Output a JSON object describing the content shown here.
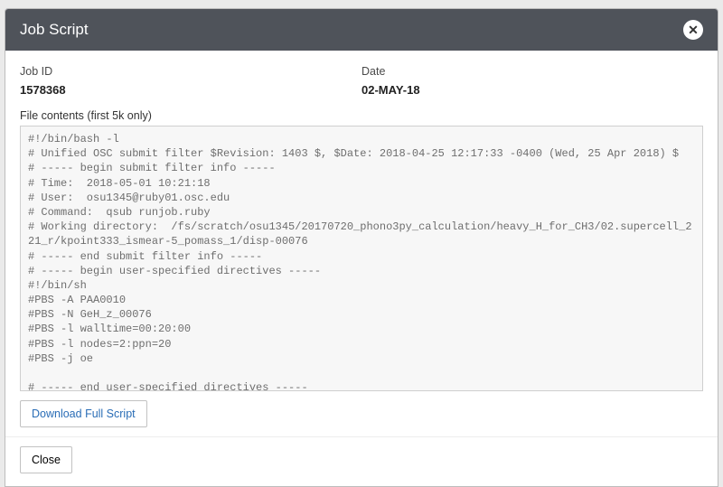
{
  "modal": {
    "title": "Job Script",
    "close_icon": "✕",
    "meta": {
      "job_id_label": "Job ID",
      "job_id_value": "1578368",
      "date_label": "Date",
      "date_value": "02-MAY-18"
    },
    "file_contents_label": "File contents (first 5k only)",
    "file_contents": "#!/bin/bash -l\n# Unified OSC submit filter $Revision: 1403 $, $Date: 2018-04-25 12:17:33 -0400 (Wed, 25 Apr 2018) $\n# ----- begin submit filter info -----\n# Time:  2018-05-01 10:21:18\n# User:  osu1345@ruby01.osc.edu\n# Command:  qsub runjob.ruby\n# Working directory:  /fs/scratch/osu1345/20170720_phono3py_calculation/heavy_H_for_CH3/02.supercell_221_r/kpoint333_ismear-5_pomass_1/disp-00076\n# ----- end submit filter info -----\n# ----- begin user-specified directives -----\n#!/bin/sh\n#PBS -A PAA0010\n#PBS -N GeH_z_00076\n#PBS -l walltime=00:20:00\n#PBS -l nodes=2:ppn=20\n#PBS -j oe\n\n# ----- end user-specified directives -----\n# ----- begin submit filter added directives -----",
    "download_button": "Download Full Script",
    "close_button": "Close"
  }
}
